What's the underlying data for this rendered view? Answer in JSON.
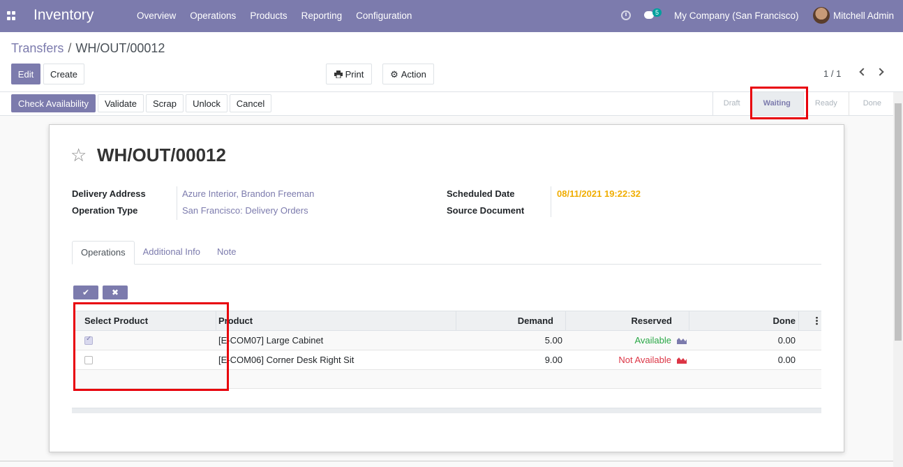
{
  "navbar": {
    "app_name": "Inventory",
    "menu": [
      "Overview",
      "Operations",
      "Products",
      "Reporting",
      "Configuration"
    ],
    "chat_count": "5",
    "company": "My Company (San Francisco)",
    "user": "Mitchell Admin"
  },
  "control_panel": {
    "breadcrumb_parent": "Transfers",
    "breadcrumb_separator": "/",
    "breadcrumb_current": "WH/OUT/00012",
    "edit_label": "Edit",
    "create_label": "Create",
    "print_label": "Print",
    "action_label": "Action",
    "pager": "1 / 1"
  },
  "statusbar": {
    "buttons": [
      "Check Availability",
      "Validate",
      "Scrap",
      "Unlock",
      "Cancel"
    ],
    "stages": [
      "Draft",
      "Waiting",
      "Ready",
      "Done"
    ],
    "active_stage": "Waiting"
  },
  "form": {
    "title": "WH/OUT/00012",
    "delivery_address_label": "Delivery Address",
    "delivery_address": "Azure Interior, Brandon Freeman",
    "operation_type_label": "Operation Type",
    "operation_type": "San Francisco: Delivery Orders",
    "scheduled_date_label": "Scheduled Date",
    "scheduled_date": "08/11/2021 19:22:32",
    "source_document_label": "Source Document",
    "tabs": [
      "Operations",
      "Additional Info",
      "Note"
    ]
  },
  "grid": {
    "confirm_icon": "check-icon",
    "discard_icon": "times-icon",
    "headers": [
      "Select Product",
      "Product",
      "Demand",
      "Reserved",
      "Done"
    ],
    "rows": [
      {
        "selected": true,
        "product": "[E-COM07] Large Cabinet",
        "demand": "5.00",
        "reserved": "Available",
        "done": "0.00"
      },
      {
        "selected": false,
        "product": "[E-COM06] Corner Desk Right Sit",
        "demand": "9.00",
        "reserved": "Not Available",
        "done": "0.00"
      }
    ]
  },
  "colors": {
    "brand": "#7c7bad",
    "available": "#28a745",
    "not_available": "#dc3545",
    "date": "#f0ad00",
    "highlight": "#e8000b"
  }
}
